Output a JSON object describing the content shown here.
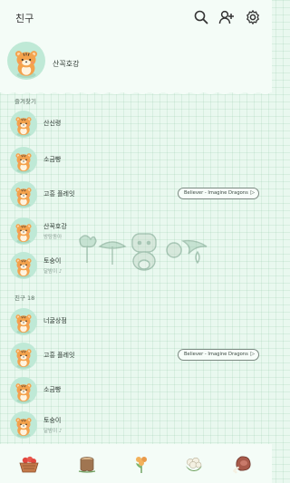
{
  "header": {
    "title": "친구",
    "icons": [
      "search-icon",
      "add-friend-icon",
      "settings-icon"
    ]
  },
  "my_profile": {
    "name": "산꼭호강"
  },
  "sections": {
    "favorites_title": "즐겨찾기",
    "friends_title": "친구 18"
  },
  "favorites": [
    {
      "name": "산신령"
    },
    {
      "name": "소금빵"
    },
    {
      "name": "고흥 플레잇",
      "music": "Believer - Imagine Dragons"
    },
    {
      "name": "산꼭호강",
      "status": "방탕동아"
    },
    {
      "name": "토숭이",
      "status": "달밤이 ♪"
    }
  ],
  "friends": [
    {
      "name": "너굴상점"
    },
    {
      "name": "고흥 플레잇",
      "music": "Believer - Imagine Dragons"
    },
    {
      "name": "소금빵"
    },
    {
      "name": "토숭이",
      "status": "달밤이 ♪"
    }
  ],
  "bottom_nav": [
    "fruit-basket-icon",
    "tree-stump-icon",
    "flower-icon",
    "cauliflower-icon",
    "meat-icon"
  ],
  "colors": {
    "background": "#e9f8ef",
    "avatar_bg": "#bfe9d6",
    "tiger_orange": "#f4a24c",
    "pill_border": "#7c8a82"
  }
}
